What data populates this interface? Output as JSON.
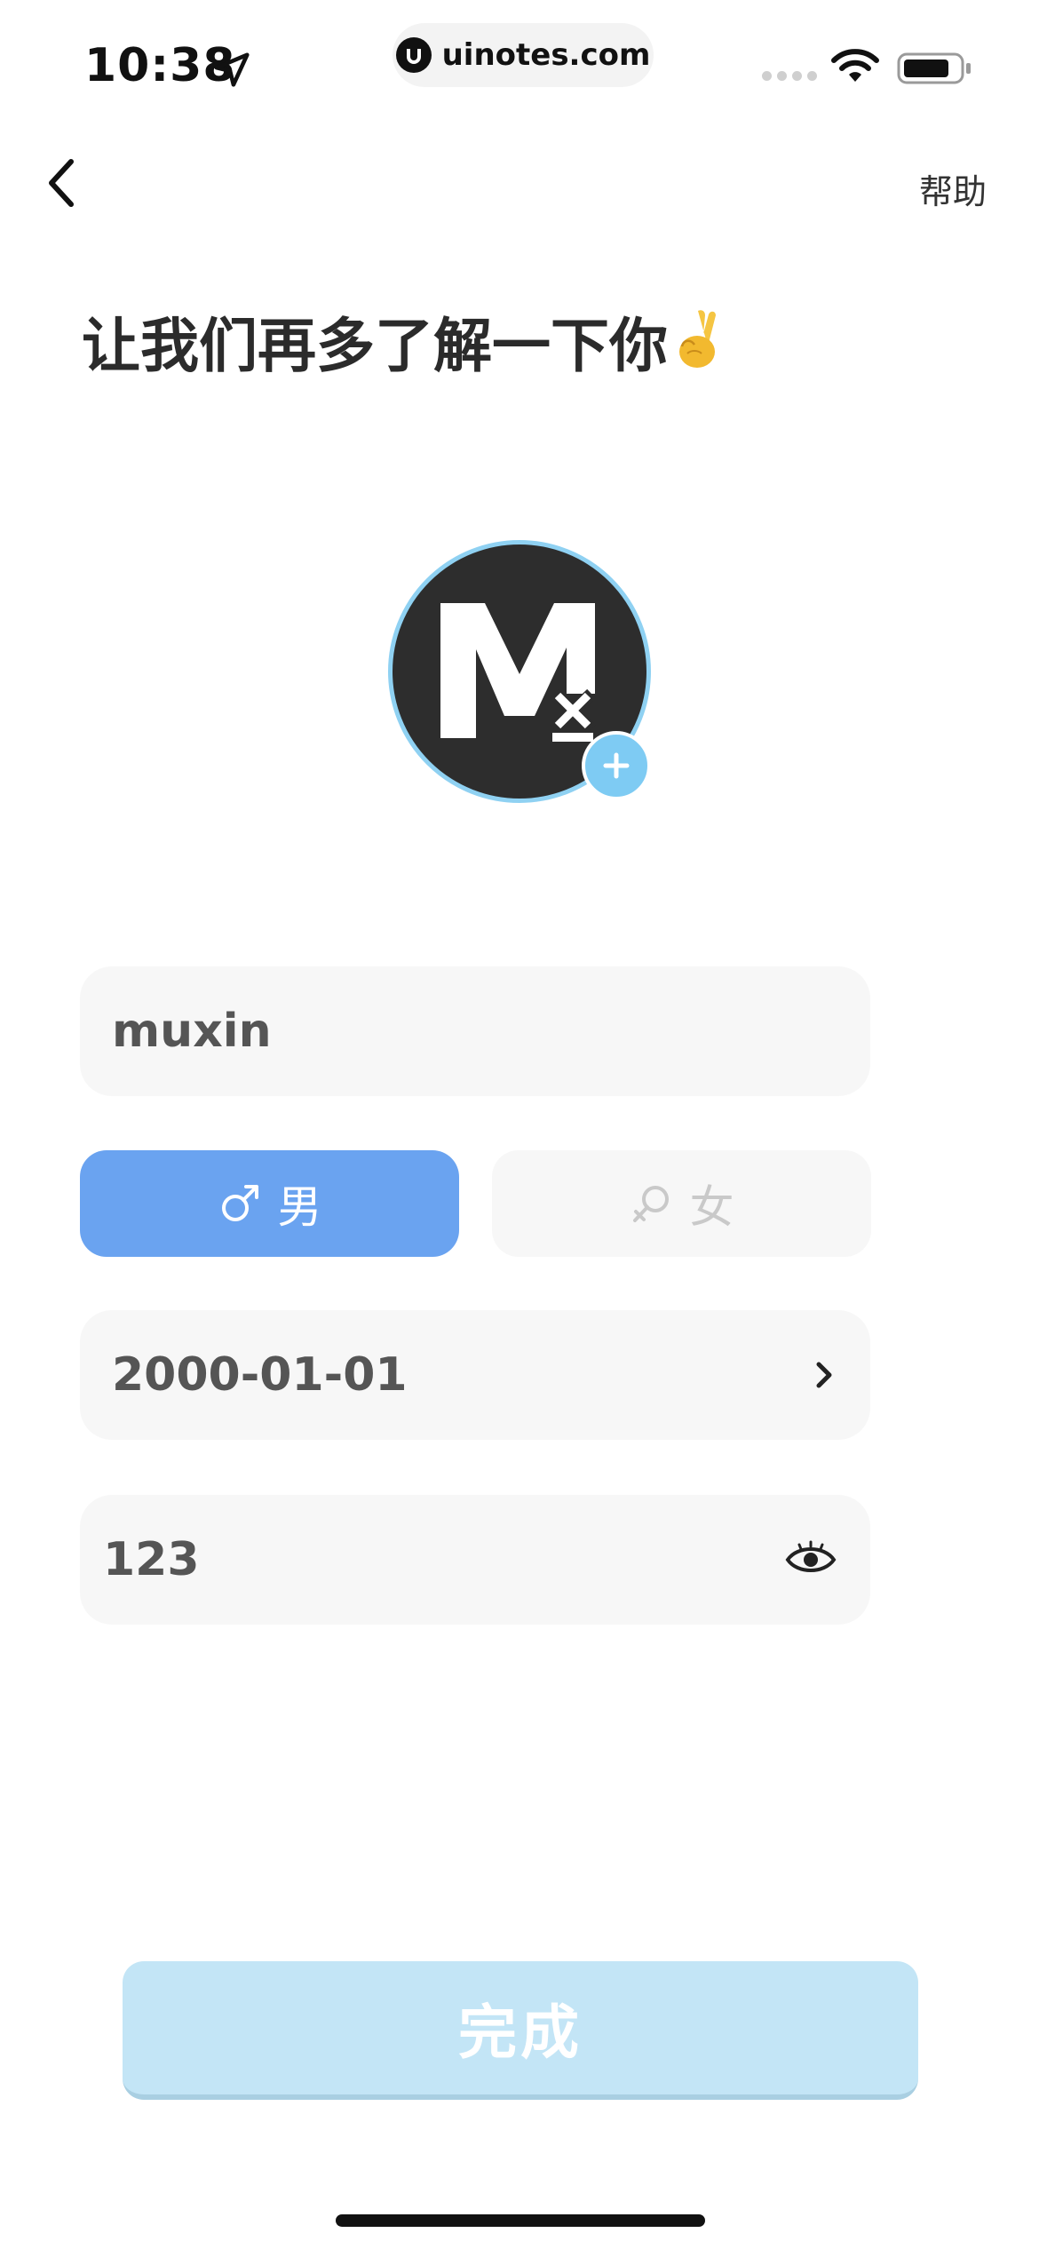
{
  "status_bar": {
    "time": "10:38",
    "url": "uinotes.com"
  },
  "nav": {
    "back_icon": "chevron-left-icon",
    "help_label": "帮助"
  },
  "page": {
    "title": "让我们再多了解一下你"
  },
  "form": {
    "nickname": "muxin",
    "gender": {
      "male_label": "男",
      "female_label": "女",
      "selected": "male"
    },
    "birthday": "2000-01-01",
    "password": "123"
  },
  "submit_label": "完成",
  "colors": {
    "accent": "#6aa3f0",
    "avatar_ring": "#8fd1f2",
    "submit_disabled": "#c3e5f6"
  }
}
